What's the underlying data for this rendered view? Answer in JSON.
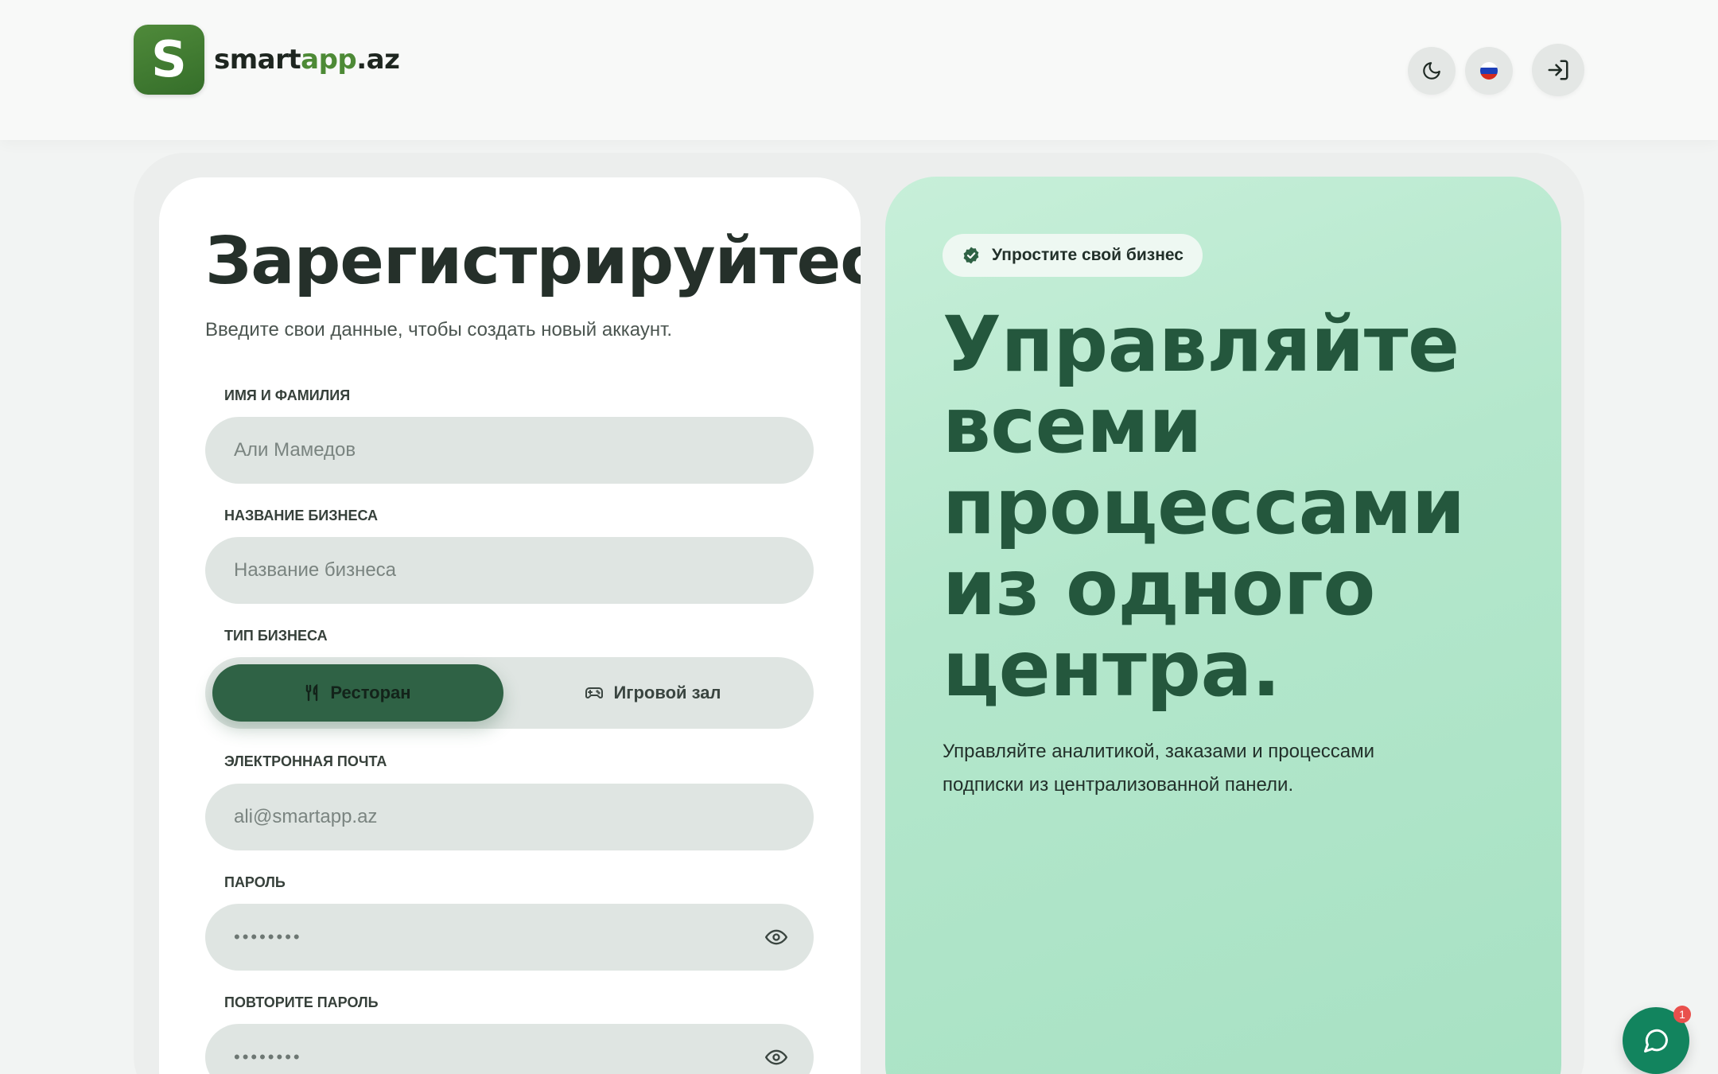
{
  "brand": {
    "logo_letter": "S",
    "name_part1": "smart",
    "name_part2": "app",
    "name_part3": ".az",
    "accent_color": "#4d8a36"
  },
  "header": {
    "theme_icon": "moon-icon",
    "language_icon": "russia-flag-icon",
    "login_icon": "login-icon"
  },
  "form": {
    "title": "Зарегистрируйтесь",
    "subtitle": "Введите свои данные, чтобы создать новый аккаунт.",
    "fields": {
      "full_name": {
        "label": "ИМЯ И ФАМИЛИЯ",
        "placeholder": "Али Мамедов"
      },
      "business_name": {
        "label": "НАЗВАНИЕ БИЗНЕСА",
        "placeholder": "Название бизнеса"
      },
      "business_type": {
        "label": "ТИП БИЗНЕСА",
        "options": [
          {
            "label": "Ресторан",
            "icon": "utensils-icon",
            "selected": true
          },
          {
            "label": "Игровой зал",
            "icon": "gamepad-icon",
            "selected": false
          }
        ]
      },
      "email": {
        "label": "ЭЛЕКТРОННАЯ ПОЧТА",
        "placeholder": "ali@smartapp.az"
      },
      "password": {
        "label": "ПАРОЛЬ",
        "value": "••••••••"
      },
      "password_repeat": {
        "label": "ПОВТОРИТЕ ПАРОЛЬ",
        "value": "••••••••"
      }
    }
  },
  "hero": {
    "badge": "Упростите свой бизнес",
    "title_lines": [
      "Управляйте",
      "всеми",
      "процессами",
      "из одного",
      "центра."
    ],
    "subtitle": "Управляйте аналитикой, заказами и процессами подписки из централизованной панели.",
    "title_color": "#24573d"
  },
  "chat": {
    "unread_count": "1"
  }
}
